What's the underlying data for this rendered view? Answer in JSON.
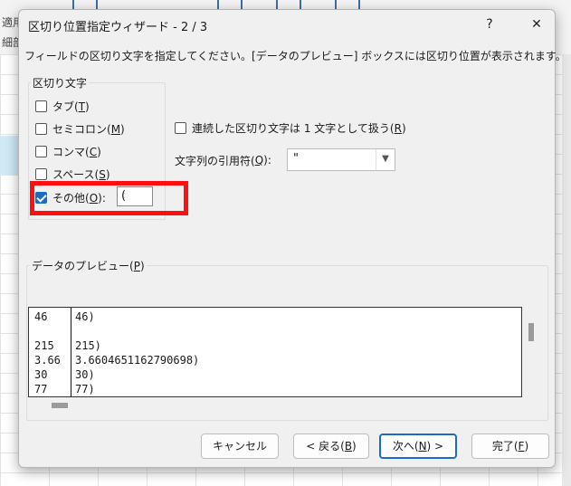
{
  "background": {
    "ribbon_label_1": "適用",
    "ribbon_label_2": "細部"
  },
  "dialog": {
    "title": "区切り位置指定ウィザード - 2 / 3",
    "help_label": "?",
    "close_label": "✕",
    "description": "フィールドの区切り文字を指定してください。[データのプレビュー] ボックスには区切り位置が表示されます。"
  },
  "delimiters": {
    "legend": "区切り文字",
    "tab": {
      "prefix": "タブ(",
      "key": "T",
      "suffix": ")",
      "checked": false
    },
    "semicolon": {
      "prefix": "セミコロン(",
      "key": "M",
      "suffix": ")",
      "checked": false
    },
    "comma": {
      "prefix": "コンマ(",
      "key": "C",
      "suffix": ")",
      "checked": false
    },
    "space": {
      "prefix": "スペース(",
      "key": "S",
      "suffix": ")",
      "checked": false
    },
    "other": {
      "prefix": "その他(",
      "key": "O",
      "suffix": "):",
      "checked": true,
      "value": "("
    }
  },
  "consecutive": {
    "prefix": "連続した区切り文字は 1 文字として扱う(",
    "key": "R",
    "suffix": ")",
    "checked": false
  },
  "text_qualifier": {
    "prefix": "文字列の引用符(",
    "key": "Q",
    "suffix": "):",
    "value": "\""
  },
  "preview": {
    "legend_prefix": "データのプレビュー(",
    "legend_key": "P",
    "legend_suffix": ")",
    "rows": [
      {
        "c1": "46",
        "c2": "46)"
      },
      {
        "c1": "",
        "c2": ""
      },
      {
        "c1": "215",
        "c2": "215)"
      },
      {
        "c1": "3.66",
        "c2": "3.6604651162790698)"
      },
      {
        "c1": "30",
        "c2": "30)"
      },
      {
        "c1": "77",
        "c2": "77)"
      }
    ]
  },
  "buttons": {
    "cancel": "キャンセル",
    "back_prefix": "< 戻る(",
    "back_key": "B",
    "back_suffix": ")",
    "next_prefix": "次へ(",
    "next_key": "N",
    "next_suffix": ") >",
    "finish_prefix": "完了(",
    "finish_key": "F",
    "finish_suffix": ")"
  },
  "colors": {
    "accent": "#1b6ac9",
    "highlight": "#ff1010"
  }
}
